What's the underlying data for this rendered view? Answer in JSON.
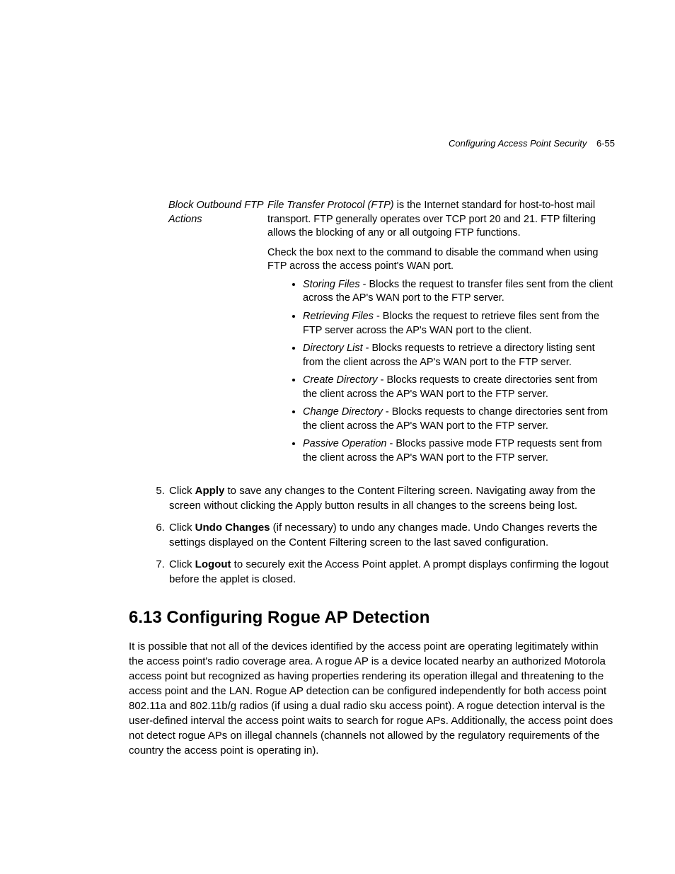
{
  "header": {
    "title": "Configuring Access Point Security",
    "pagenum": "6-55"
  },
  "def": {
    "label": "Block Outbound FTP Actions",
    "ftp_term": "File Transfer Protocol (FTP)",
    "desc_rest": " is the Internet standard for host-to-host mail transport. FTP generally operates over TCP port 20 and 21. FTP filtering allows the blocking of any or all outgoing FTP functions.",
    "check_para_a": "Check the box next to the command to disable the command when using FTP across the ",
    "check_para_b": "access point's",
    "check_para_c": " WAN port.",
    "bullets": [
      {
        "term": "Storing Files",
        "rest": " - Blocks the request to transfer files sent from the client across the AP's WAN port to the FTP server."
      },
      {
        "term": "Retrieving Files",
        "rest": " - Blocks the request to retrieve files sent from the FTP server across the AP's WAN port to the client."
      },
      {
        "term": "Directory List",
        "rest": " - Blocks requests to retrieve a directory listing sent from the client across the AP's WAN port to the FTP server."
      },
      {
        "term": "Create Directory",
        "rest": " - Blocks requests to create directories sent from the client across the AP's WAN port to the FTP server."
      },
      {
        "term": "Change Directory",
        "rest": " - Blocks requests to change directories sent from the client across the AP's WAN port to the FTP server."
      },
      {
        "term": "Passive Operation",
        "rest": " - Blocks passive mode FTP requests sent from the client across the AP's WAN port to the FTP server."
      }
    ]
  },
  "steps": [
    {
      "pre": "Click ",
      "bold": "Apply",
      "post": " to save any changes to the Content Filtering screen. Navigating away from the screen without clicking the Apply button results in all changes to the screens being lost."
    },
    {
      "pre": "Click ",
      "bold": "Undo Changes",
      "post": " (if necessary) to undo any changes made. Undo Changes reverts the settings displayed on the Content Filtering screen to the last saved configuration."
    },
    {
      "pre": "Click ",
      "bold": "Logout",
      "post": " to securely exit the Access Point applet. A prompt displays confirming the logout before the applet is closed."
    }
  ],
  "section": {
    "heading": "6.13 Configuring Rogue AP Detection",
    "body": "It is possible that not all of the devices identified by the access point are operating legitimately within the access point's radio coverage area. A rogue AP is a device located nearby an authorized Motorola access point but recognized as having properties rendering its operation illegal and threatening to the access point and the LAN. Rogue AP detection can be configured independently for both access point 802.11a and 802.11b/g radios (if using a dual radio sku access point). A rogue detection interval is the user-defined interval the access point waits to search for rogue APs. Additionally, the access point does not detect rogue APs on illegal channels (channels not allowed by the regulatory requirements of the country the access point is operating in)."
  }
}
